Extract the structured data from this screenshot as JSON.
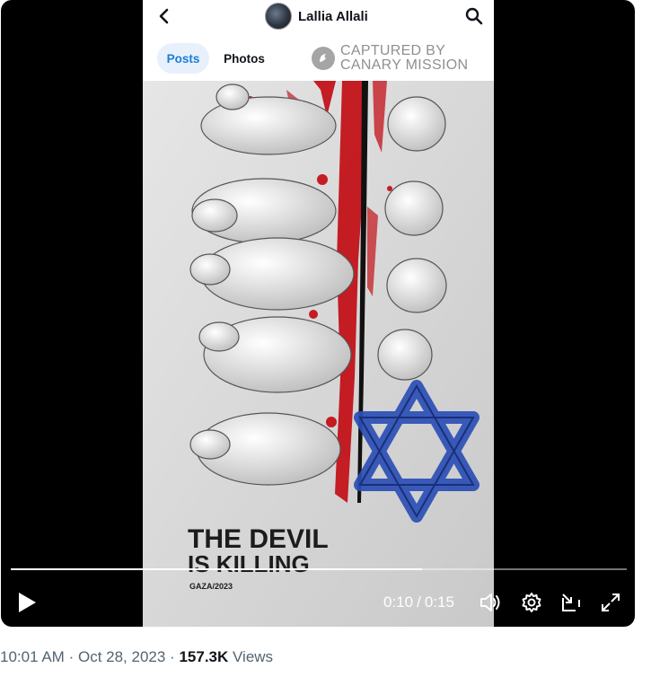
{
  "profile": {
    "name": "Lallia Allali",
    "tabs": [
      {
        "label": "Posts",
        "active": true
      },
      {
        "label": "Photos",
        "active": false
      }
    ]
  },
  "watermark": {
    "line1": "CAPTURED BY",
    "line2": "CANARY MISSION"
  },
  "artwork": {
    "title_line1": "THE DEVIL",
    "title_line2": "IS KILLING",
    "caption": "GAZA/2023"
  },
  "player": {
    "current_time": "0:10",
    "separator": "/",
    "duration": "0:15",
    "progress_fraction": 0.667,
    "icons": [
      "play-icon",
      "volume-icon",
      "settings-icon",
      "pip-icon",
      "fullscreen-icon"
    ]
  },
  "tweet": {
    "time": "10:01 AM",
    "date": "Oct 28, 2023",
    "views_count": "157.3K",
    "views_label": "Views",
    "dot": "·"
  },
  "colors": {
    "accent": "#1d7bd8",
    "blood_red": "#c20d14",
    "star_blue": "#2c4fb5"
  }
}
